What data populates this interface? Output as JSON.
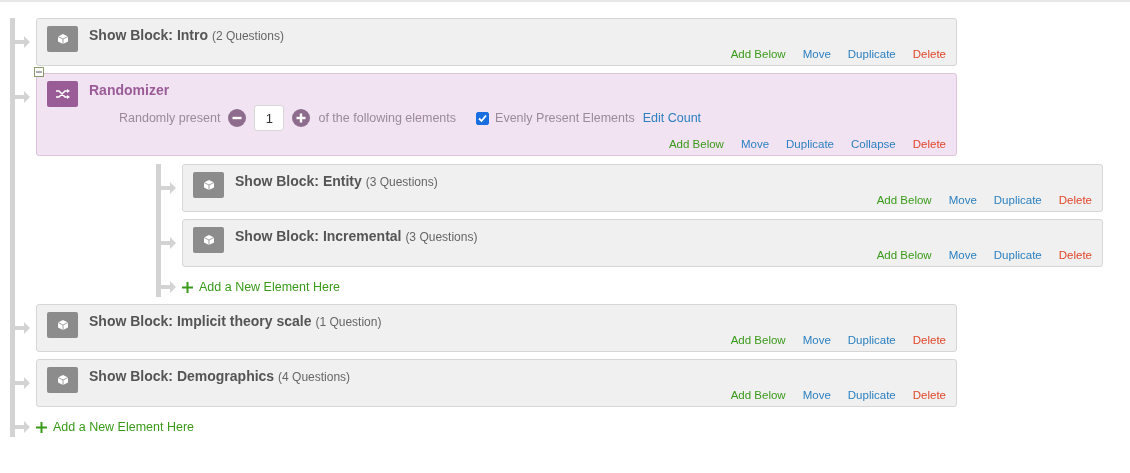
{
  "flow": {
    "elements": [
      {
        "kind": "block",
        "title": "Show Block: Intro",
        "count": "(2 Questions)",
        "actions": [
          {
            "kind": "add",
            "label": "Add Below"
          },
          {
            "kind": "move",
            "label": "Move"
          },
          {
            "kind": "duplicate",
            "label": "Duplicate"
          },
          {
            "kind": "delete",
            "label": "Delete"
          }
        ]
      },
      {
        "kind": "randomizer",
        "title": "Randomizer",
        "expanded": true,
        "options": {
          "prefix": "Randomly present",
          "value": "1",
          "suffix": "of the following elements",
          "evenly": {
            "label": "Evenly Present Elements",
            "checked": true
          },
          "edit_link": "Edit Count"
        },
        "actions": [
          {
            "kind": "add",
            "label": "Add Below"
          },
          {
            "kind": "move",
            "label": "Move"
          },
          {
            "kind": "duplicate",
            "label": "Duplicate"
          },
          {
            "kind": "collapse",
            "label": "Collapse"
          },
          {
            "kind": "delete",
            "label": "Delete"
          }
        ],
        "children": [
          {
            "kind": "block",
            "title": "Show Block: Entity",
            "count": "(3 Questions)",
            "actions": [
              {
                "kind": "add",
                "label": "Add Below"
              },
              {
                "kind": "move",
                "label": "Move"
              },
              {
                "kind": "duplicate",
                "label": "Duplicate"
              },
              {
                "kind": "delete",
                "label": "Delete"
              }
            ]
          },
          {
            "kind": "block",
            "title": "Show Block: Incremental",
            "count": "(3 Questions)",
            "actions": [
              {
                "kind": "add",
                "label": "Add Below"
              },
              {
                "kind": "move",
                "label": "Move"
              },
              {
                "kind": "duplicate",
                "label": "Duplicate"
              },
              {
                "kind": "delete",
                "label": "Delete"
              }
            ]
          }
        ],
        "add_link": "Add a New Element Here"
      },
      {
        "kind": "block",
        "title": "Show Block: Implicit theory scale",
        "count": "(1 Question)",
        "actions": [
          {
            "kind": "add",
            "label": "Add Below"
          },
          {
            "kind": "move",
            "label": "Move"
          },
          {
            "kind": "duplicate",
            "label": "Duplicate"
          },
          {
            "kind": "delete",
            "label": "Delete"
          }
        ]
      },
      {
        "kind": "block",
        "title": "Show Block: Demographics",
        "count": "(4 Questions)",
        "actions": [
          {
            "kind": "add",
            "label": "Add Below"
          },
          {
            "kind": "move",
            "label": "Move"
          },
          {
            "kind": "duplicate",
            "label": "Duplicate"
          },
          {
            "kind": "delete",
            "label": "Delete"
          }
        ]
      }
    ],
    "add_link": "Add a New Element Here"
  }
}
